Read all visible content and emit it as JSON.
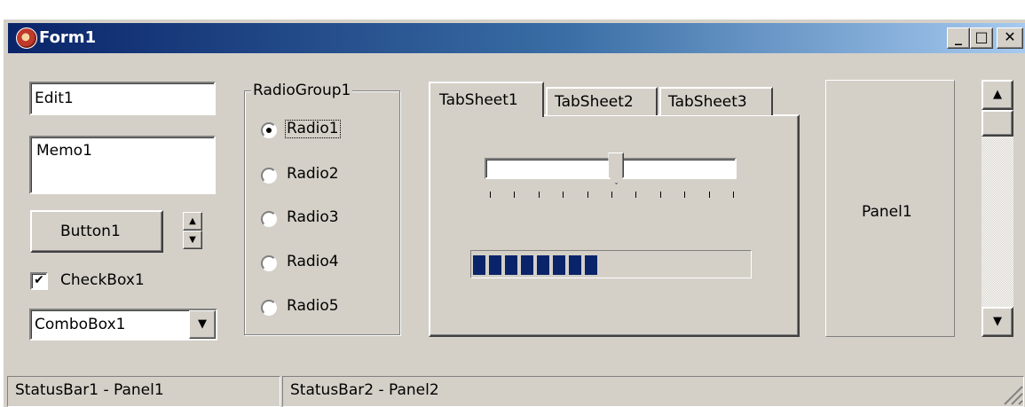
{
  "window": {
    "title": "Form1",
    "min_label": "_",
    "max_label": "□",
    "close_label": "✕"
  },
  "edit": {
    "value": "Edit1"
  },
  "memo": {
    "value": "Memo1"
  },
  "button": {
    "label": "Button1"
  },
  "spin": {
    "up": "▲",
    "down": "▼"
  },
  "checkbox": {
    "label": "CheckBox1",
    "checked": true,
    "mark": "✔"
  },
  "combobox": {
    "value": "ComboBox1",
    "arrow": "▼"
  },
  "radiogroup": {
    "title": "RadioGroup1",
    "selected": "Radio1",
    "items": [
      "Radio1",
      "Radio2",
      "Radio3",
      "Radio4",
      "Radio5"
    ]
  },
  "tabs": {
    "labels": [
      "TabSheet1",
      "TabSheet2",
      "TabSheet3"
    ],
    "active": "TabSheet1"
  },
  "trackbar": {
    "position_fraction": 0.52,
    "tick_count": 11
  },
  "progressbar": {
    "position_fraction": 0.47,
    "blocks": 8
  },
  "panel": {
    "label": "Panel1"
  },
  "scrollbar": {
    "up": "▲",
    "down": "▼"
  },
  "statusbar": {
    "panel1": "StatusBar1 - Panel1",
    "panel2": "StatusBar2 - Panel2"
  },
  "colors": {
    "face": "#d4d0c8",
    "titlebar_start": "#0a246a",
    "titlebar_end": "#a6caf0",
    "progress": "#0a246a"
  }
}
